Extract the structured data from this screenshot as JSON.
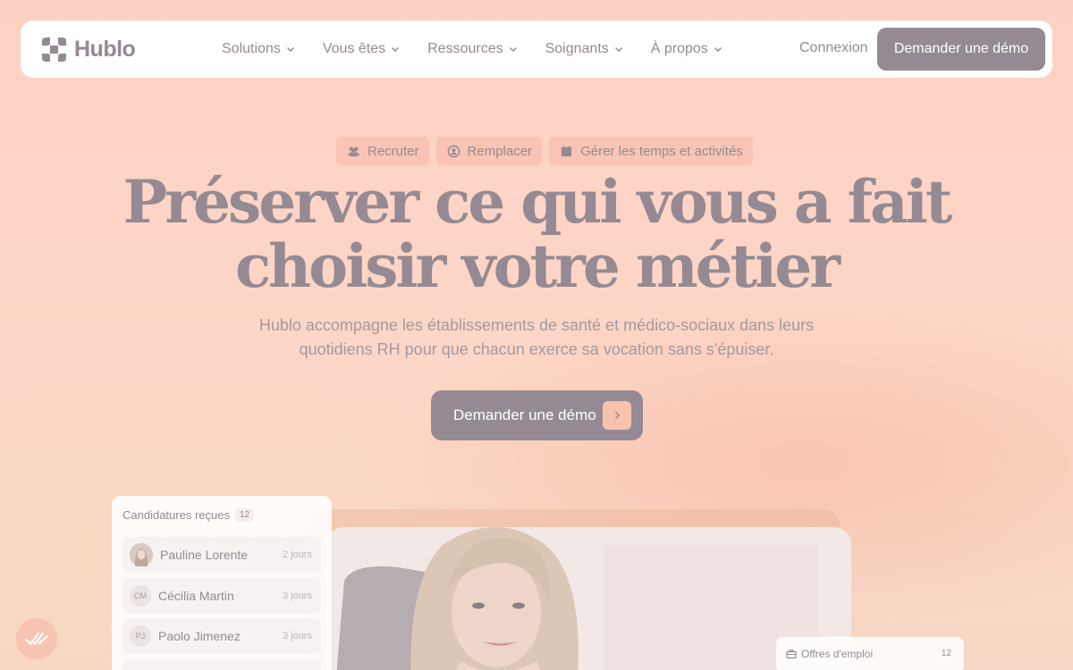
{
  "brand": {
    "name": "Hublo"
  },
  "nav": {
    "items": [
      {
        "label": "Solutions"
      },
      {
        "label": "Vous êtes"
      },
      {
        "label": "Ressources"
      },
      {
        "label": "Soignants"
      },
      {
        "label": "À propos"
      }
    ],
    "login_label": "Connexion",
    "cta_label": "Demander une démo"
  },
  "hero": {
    "chips": [
      {
        "label": "Recruter",
        "icon": "people-icon"
      },
      {
        "label": "Remplacer",
        "icon": "swap-person-icon"
      },
      {
        "label": "Gérer les temps et activités",
        "icon": "calendar-icon"
      }
    ],
    "title_line1": "Préserver ce qui vous a fait",
    "title_line2": "choisir votre métier",
    "subtitle_line1": "Hublo accompagne les établissements de santé et médico-sociaux dans leurs",
    "subtitle_line2": "quotidiens RH pour que chacun exerce sa vocation sans s'épuiser.",
    "cta_label": "Demander une démo"
  },
  "candidatures": {
    "title": "Candidatures reçues",
    "count": "12",
    "rows": [
      {
        "initials": "",
        "name": "Pauline Lorente",
        "time": "2 jours"
      },
      {
        "initials": "CM",
        "name": "Cécilia Martin",
        "time": "3 jours"
      },
      {
        "initials": "PJ",
        "name": "Paolo Jimenez",
        "time": "3 jours"
      }
    ]
  },
  "offres": {
    "label": "Offres d'emploi",
    "count": "12"
  },
  "colors": {
    "accent": "#958a93",
    "cta_arrow_bg": "#f6c3ad",
    "background": "#fcd1c3"
  }
}
